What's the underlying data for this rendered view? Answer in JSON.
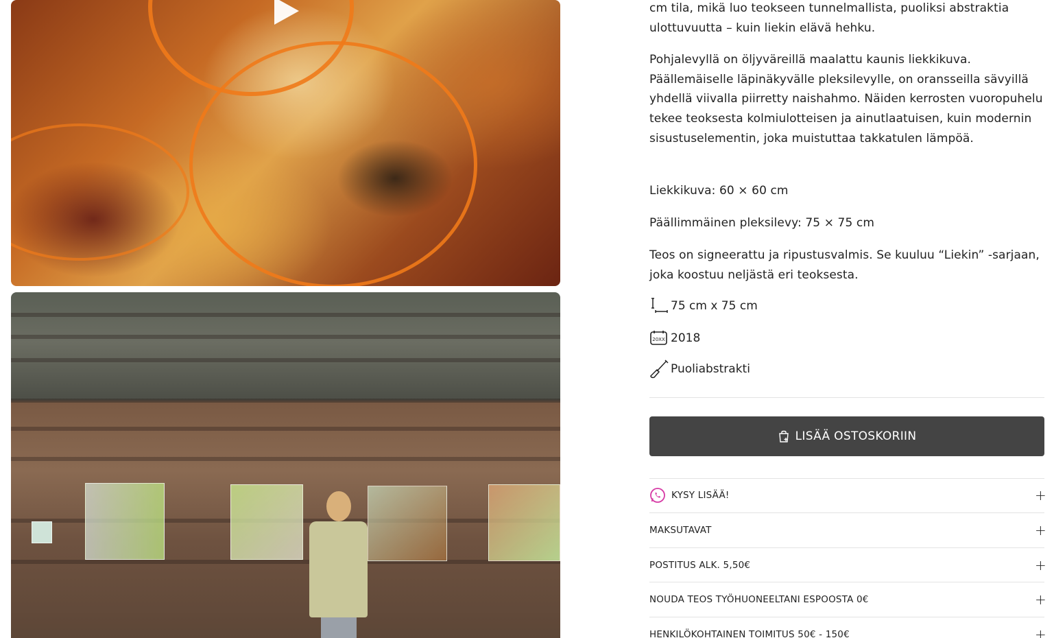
{
  "gallery": {
    "items": [
      {
        "kind": "video",
        "alt": "Liekkikuva"
      },
      {
        "kind": "image",
        "alt": "Taiteilija näyttelyssä"
      }
    ]
  },
  "description": {
    "intro_lines": "cm tila, mikä luo teokseen tunnelmallista, puoliksi abstraktia ulottuvuutta – kuin liekin elävä hehku.",
    "paragraph_1": "Pohjalevyllä on öljyväreillä maalattu kaunis liekkikuva. Päällemäiselle läpinäkyvälle pleksilevylle, on oransseilla sävyillä yhdellä viivalla piirretty naishahmo. Näiden kerrosten vuoropuhelu tekee teoksesta kolmiulotteisen ja ainutlaatuisen, kuin modernin sisustuselementin, joka muistuttaa takkatulen lämpöä.",
    "paragraph_2": "Liekkikuva: 60 × 60 cm",
    "paragraph_3": "Päällimmäinen pleksilevy: 75 × 75 cm",
    "paragraph_4": "Teos on signeerattu ja ripustusvalmis. Se kuuluu “Liekin” -sarjaan, joka koostuu neljästä eri teoksesta."
  },
  "attributes": {
    "size": {
      "icon": "ruler-size-icon",
      "value": "75 cm x 75 cm"
    },
    "year": {
      "icon": "calendar-icon",
      "value": "2018"
    },
    "style": {
      "icon": "paintbrush-icon",
      "value": "Puoliabstrakti"
    }
  },
  "cart": {
    "label": "LISÄÄ OSTOSKORIIN",
    "icon": "shopping-bag-add-icon",
    "color": "#444444"
  },
  "accordion": [
    {
      "label": "KYSY LISÄÄ!",
      "icon": "whatsapp-icon",
      "icon_color": "#d63aa5"
    },
    {
      "label": "MAKSUTAVAT"
    },
    {
      "label": "POSTITUS ALK. 5,50€"
    },
    {
      "label": "NOUDA TEOS TYÖHUONEELTANI ESPOOSTA 0€"
    },
    {
      "label": "HENKILÖKOHTAINEN TOIMITUS 50€ - 150€"
    }
  ],
  "accordion_toggle": "+"
}
